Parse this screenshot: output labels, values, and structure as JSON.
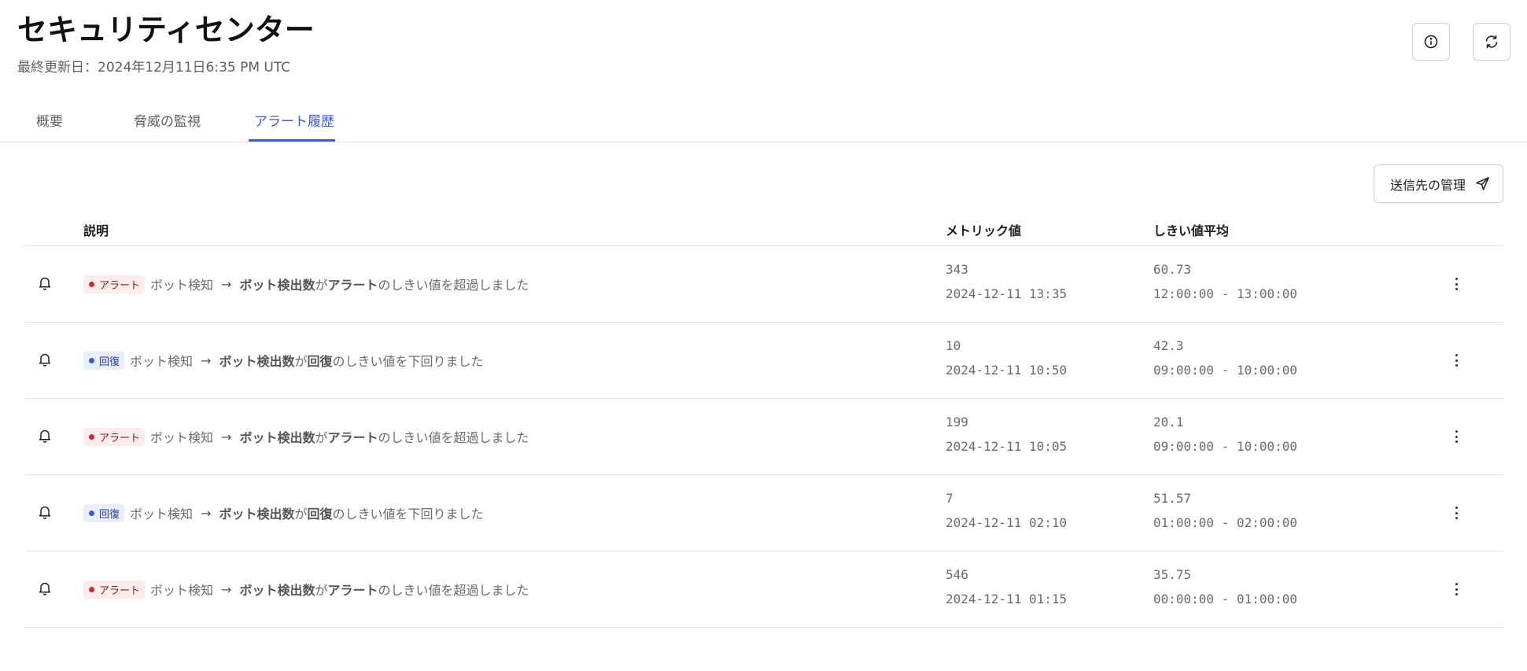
{
  "header": {
    "title": "セキュリティセンター",
    "last_updated": "最終更新日：2024年12月11日6:35 PM UTC"
  },
  "toolbar": {
    "info_icon": "info-icon",
    "refresh_icon": "refresh-icon"
  },
  "tabs": [
    {
      "label": "概要",
      "active": false
    },
    {
      "label": "脅威の監視",
      "active": false
    },
    {
      "label": "アラート履歴",
      "active": true
    }
  ],
  "manage_button": {
    "label": "送信先の管理",
    "icon": "send-icon"
  },
  "table": {
    "columns": [
      "説明",
      "メトリック値",
      "しきい値平均"
    ],
    "rows": [
      {
        "status": "alert",
        "badge": "アラート",
        "source": "ボット検知",
        "arrow": "→",
        "metric": "ボット検出数",
        "particle": "が",
        "state": "アラート",
        "suffix": "のしきい値を超過しました",
        "value": "343",
        "time": "2024-12-11 13:35",
        "threshold": "60.73",
        "range": "12:00:00 - 13:00:00"
      },
      {
        "status": "recover",
        "badge": "回復",
        "source": "ボット検知",
        "arrow": "→",
        "metric": "ボット検出数",
        "particle": "が",
        "state": "回復",
        "suffix": "のしきい値を下回りました",
        "value": "10",
        "time": "2024-12-11 10:50",
        "threshold": "42.3",
        "range": "09:00:00 - 10:00:00"
      },
      {
        "status": "alert",
        "badge": "アラート",
        "source": "ボット検知",
        "arrow": "→",
        "metric": "ボット検出数",
        "particle": "が",
        "state": "アラート",
        "suffix": "のしきい値を超過しました",
        "value": "199",
        "time": "2024-12-11 10:05",
        "threshold": "20.1",
        "range": "09:00:00 - 10:00:00"
      },
      {
        "status": "recover",
        "badge": "回復",
        "source": "ボット検知",
        "arrow": "→",
        "metric": "ボット検出数",
        "particle": "が",
        "state": "回復",
        "suffix": "のしきい値を下回りました",
        "value": "7",
        "time": "2024-12-11 02:10",
        "threshold": "51.57",
        "range": "01:00:00 - 02:00:00"
      },
      {
        "status": "alert",
        "badge": "アラート",
        "source": "ボット検知",
        "arrow": "→",
        "metric": "ボット検出数",
        "particle": "が",
        "state": "アラート",
        "suffix": "のしきい値を超過しました",
        "value": "546",
        "time": "2024-12-11 01:15",
        "threshold": "35.75",
        "range": "00:00:00 - 01:00:00"
      }
    ]
  },
  "colors": {
    "accent": "#3b5bcf",
    "alert": "#d02a2a",
    "recover": "#3b5bcf"
  }
}
